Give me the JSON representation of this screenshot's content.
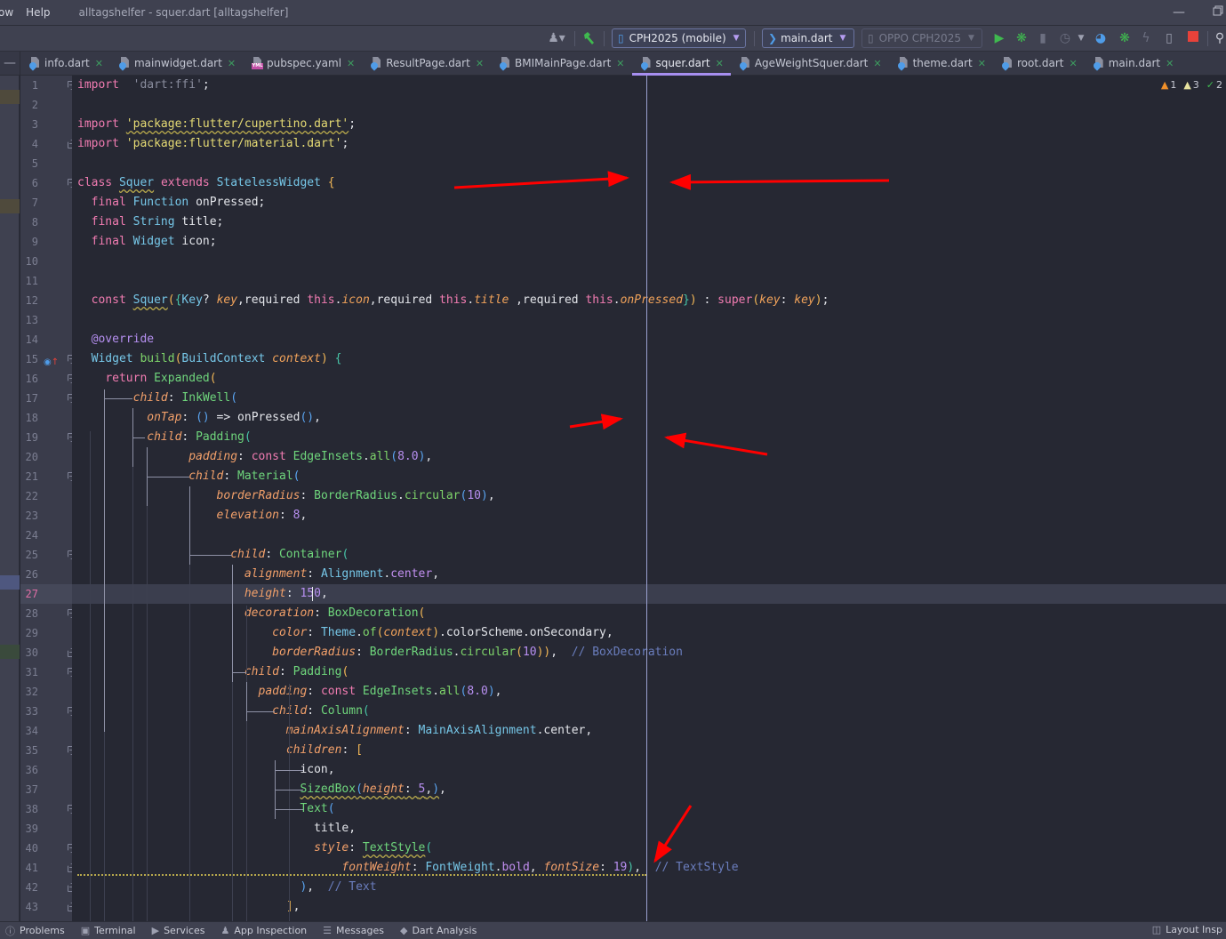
{
  "titlebar": {
    "menus": [
      "ow",
      "Help"
    ],
    "window_title": "alltagshelfer - squer.dart [alltagshelfer]",
    "minimize_icon": "minimize-icon",
    "restore_icon": "restore-icon"
  },
  "toolbar": {
    "device_combo": "CPH2025 (mobile)",
    "run_config_combo": "main.dart",
    "target_device_combo": "OPPO CPH2025",
    "icons": [
      "user-icon",
      "build-hammer-icon",
      "run-icon",
      "debug-icon",
      "attach-icon",
      "profile-icon",
      "more-dropdown-icon",
      "performance-icon",
      "debug-attach-icon",
      "hot-reload-icon",
      "device-manager-icon",
      "stop-icon",
      "search-icon"
    ],
    "colors": {
      "run": "#3fb94f",
      "stop": "#e8423a",
      "accent": "#a78ff0"
    }
  },
  "tabs": [
    {
      "label": "info.dart",
      "type": "dart"
    },
    {
      "label": "mainwidget.dart",
      "type": "dart"
    },
    {
      "label": "pubspec.yaml",
      "type": "yaml"
    },
    {
      "label": "ResultPage.dart",
      "type": "dart"
    },
    {
      "label": "BMIMainPage.dart",
      "type": "dart"
    },
    {
      "label": "squer.dart",
      "type": "dart",
      "active": true
    },
    {
      "label": "AgeWeightSquer.dart",
      "type": "dart"
    },
    {
      "label": "theme.dart",
      "type": "dart"
    },
    {
      "label": "root.dart",
      "type": "dart"
    },
    {
      "label": "main.dart",
      "type": "dart"
    }
  ],
  "inspections": {
    "errors": "1",
    "warnings": "3",
    "weak_warnings": "2"
  },
  "editor": {
    "current_line": 27,
    "line_numbers": [
      "1",
      "2",
      "3",
      "4",
      "5",
      "6",
      "7",
      "8",
      "9",
      "10",
      "11",
      "12",
      "13",
      "14",
      "15",
      "16",
      "17",
      "18",
      "19",
      "20",
      "21",
      "22",
      "23",
      "24",
      "25",
      "26",
      "27",
      "28",
      "29",
      "30",
      "31",
      "32",
      "33",
      "34",
      "35",
      "36",
      "37",
      "38",
      "39",
      "40",
      "41",
      "42",
      "43"
    ],
    "lines": [
      [
        [
          "kw",
          "import"
        ],
        [
          "",
          "  "
        ],
        [
          "str-gray",
          "'dart:ffi'"
        ],
        [
          "",
          ";"
        ]
      ],
      [],
      [
        [
          "kw",
          "import"
        ],
        [
          "",
          " "
        ],
        [
          "str squiggle",
          "'package:flutter/cupertino.dart'"
        ],
        [
          "",
          ";"
        ]
      ],
      [
        [
          "kw",
          "import"
        ],
        [
          "",
          " "
        ],
        [
          "str",
          "'package:flutter/material.dart'"
        ],
        [
          "",
          ";"
        ]
      ],
      [],
      [
        [
          "kw",
          "class"
        ],
        [
          "",
          " "
        ],
        [
          "cls squiggle",
          "Squer"
        ],
        [
          "",
          " "
        ],
        [
          "kw",
          "extends"
        ],
        [
          "",
          " "
        ],
        [
          "cls",
          "StatelessWidget"
        ],
        [
          "",
          " "
        ],
        [
          "paren",
          "{"
        ]
      ],
      [
        [
          "",
          "  "
        ],
        [
          "kw",
          "final"
        ],
        [
          "",
          " "
        ],
        [
          "cls",
          "Function"
        ],
        [
          "",
          " onPressed;"
        ]
      ],
      [
        [
          "",
          "  "
        ],
        [
          "kw",
          "final"
        ],
        [
          "",
          " "
        ],
        [
          "cls",
          "String"
        ],
        [
          "",
          " title;"
        ]
      ],
      [
        [
          "",
          "  "
        ],
        [
          "kw",
          "final"
        ],
        [
          "",
          " "
        ],
        [
          "cls",
          "Widget"
        ],
        [
          "",
          " icon;"
        ]
      ],
      [],
      [],
      [
        [
          "",
          "  "
        ],
        [
          "kw",
          "const"
        ],
        [
          "",
          " "
        ],
        [
          "cls squiggle",
          "Squer"
        ],
        [
          "paren",
          "("
        ],
        [
          "paren3",
          "{"
        ],
        [
          "cls",
          "Key"
        ],
        [
          "",
          "? "
        ],
        [
          "param",
          "key"
        ],
        [
          "",
          ",required "
        ],
        [
          "kw",
          "this"
        ],
        [
          "",
          "."
        ],
        [
          "param",
          "icon"
        ],
        [
          "",
          ",required "
        ],
        [
          "kw",
          "this"
        ],
        [
          "",
          "."
        ],
        [
          "param",
          "title"
        ],
        [
          "",
          " ,required "
        ],
        [
          "kw",
          "this"
        ],
        [
          "",
          "."
        ],
        [
          "param",
          "onPressed"
        ],
        [
          "paren3",
          "}"
        ],
        [
          "paren",
          ")"
        ],
        [
          "",
          " : "
        ],
        [
          "kw",
          "super"
        ],
        [
          "paren",
          "("
        ],
        [
          "param",
          "key"
        ],
        [
          "",
          ": "
        ],
        [
          "param",
          "key"
        ],
        [
          "paren",
          ")"
        ],
        [
          "",
          ";"
        ]
      ],
      [],
      [
        [
          "",
          "  "
        ],
        [
          "meta",
          "@override"
        ]
      ],
      [
        [
          "",
          "  "
        ],
        [
          "cls",
          "Widget"
        ],
        [
          "",
          " "
        ],
        [
          "fn",
          "build"
        ],
        [
          "paren",
          "("
        ],
        [
          "cls",
          "BuildContext"
        ],
        [
          "",
          " "
        ],
        [
          "param",
          "context"
        ],
        [
          "paren",
          ")"
        ],
        [
          "",
          " "
        ],
        [
          "paren3",
          "{"
        ]
      ],
      [
        [
          "",
          "    "
        ],
        [
          "kw",
          "return"
        ],
        [
          "",
          " "
        ],
        [
          "ctor",
          "Expanded"
        ],
        [
          "paren",
          "("
        ]
      ],
      [
        [
          "",
          "        "
        ],
        [
          "prop",
          "child"
        ],
        [
          "",
          ": "
        ],
        [
          "ctor",
          "InkWell"
        ],
        [
          "paren2",
          "("
        ]
      ],
      [
        [
          "",
          "          "
        ],
        [
          "prop",
          "onTap"
        ],
        [
          "",
          ": "
        ],
        [
          "paren2",
          "()"
        ],
        [
          "",
          " => onPressed"
        ],
        [
          "paren2",
          "()"
        ],
        [
          "",
          ","
        ]
      ],
      [
        [
          "",
          "          "
        ],
        [
          "prop",
          "child"
        ],
        [
          "",
          ": "
        ],
        [
          "ctor",
          "Padding"
        ],
        [
          "paren3",
          "("
        ]
      ],
      [
        [
          "",
          "                "
        ],
        [
          "prop",
          "padding"
        ],
        [
          "",
          ": "
        ],
        [
          "kw",
          "const"
        ],
        [
          "",
          " "
        ],
        [
          "ctor",
          "EdgeInsets"
        ],
        [
          "",
          "."
        ],
        [
          "fn",
          "all"
        ],
        [
          "paren2",
          "("
        ],
        [
          "num",
          "8.0"
        ],
        [
          "paren2",
          ")"
        ],
        [
          "",
          ","
        ]
      ],
      [
        [
          "",
          "                "
        ],
        [
          "prop",
          "child"
        ],
        [
          "",
          ": "
        ],
        [
          "ctor",
          "Material"
        ],
        [
          "paren2",
          "("
        ]
      ],
      [
        [
          "",
          "                    "
        ],
        [
          "prop",
          "borderRadius"
        ],
        [
          "",
          ": "
        ],
        [
          "ctor",
          "BorderRadius"
        ],
        [
          "",
          "."
        ],
        [
          "fn",
          "circular"
        ],
        [
          "paren2",
          "("
        ],
        [
          "num",
          "10"
        ],
        [
          "paren2",
          ")"
        ],
        [
          "",
          ","
        ]
      ],
      [
        [
          "",
          "                    "
        ],
        [
          "prop",
          "elevation"
        ],
        [
          "",
          ": "
        ],
        [
          "num",
          "8"
        ],
        [
          "",
          ","
        ]
      ],
      [],
      [
        [
          "",
          "                      "
        ],
        [
          "prop",
          "child"
        ],
        [
          "",
          ": "
        ],
        [
          "ctor",
          "Container"
        ],
        [
          "paren3",
          "("
        ]
      ],
      [
        [
          "",
          "                        "
        ],
        [
          "prop",
          "alignment"
        ],
        [
          "",
          ": "
        ],
        [
          "cls",
          "Alignment"
        ],
        [
          "",
          "."
        ],
        [
          "enumv",
          "center"
        ],
        [
          "",
          ","
        ]
      ],
      [
        [
          "",
          "                        "
        ],
        [
          "prop",
          "height"
        ],
        [
          "",
          ": "
        ],
        [
          "num",
          "150"
        ],
        [
          "",
          ","
        ]
      ],
      [
        [
          "",
          "                        "
        ],
        [
          "prop",
          "decoration"
        ],
        [
          "",
          ": "
        ],
        [
          "ctor",
          "BoxDecoration"
        ],
        [
          "paren",
          "("
        ]
      ],
      [
        [
          "",
          "                            "
        ],
        [
          "prop",
          "color"
        ],
        [
          "",
          ": "
        ],
        [
          "cls",
          "Theme"
        ],
        [
          "",
          "."
        ],
        [
          "fn",
          "of"
        ],
        [
          "paren",
          "("
        ],
        [
          "param",
          "context"
        ],
        [
          "paren",
          ")"
        ],
        [
          "",
          ".colorScheme.onSecondary,"
        ]
      ],
      [
        [
          "",
          "                            "
        ],
        [
          "prop",
          "borderRadius"
        ],
        [
          "",
          ": "
        ],
        [
          "ctor",
          "BorderRadius"
        ],
        [
          "",
          "."
        ],
        [
          "fn",
          "circular"
        ],
        [
          "paren",
          "("
        ],
        [
          "num",
          "10"
        ],
        [
          "paren",
          "))"
        ],
        [
          "",
          ",  "
        ],
        [
          "cmt",
          "// BoxDecoration"
        ]
      ],
      [
        [
          "",
          "                        "
        ],
        [
          "prop",
          "child"
        ],
        [
          "",
          ": "
        ],
        [
          "ctor",
          "Padding"
        ],
        [
          "paren",
          "("
        ]
      ],
      [
        [
          "",
          "                          "
        ],
        [
          "prop",
          "padding"
        ],
        [
          "",
          ": "
        ],
        [
          "kw",
          "const"
        ],
        [
          "",
          " "
        ],
        [
          "ctor",
          "EdgeInsets"
        ],
        [
          "",
          "."
        ],
        [
          "fn",
          "all"
        ],
        [
          "paren2",
          "("
        ],
        [
          "num",
          "8.0"
        ],
        [
          "paren2",
          ")"
        ],
        [
          "",
          ","
        ]
      ],
      [
        [
          "",
          "                            "
        ],
        [
          "prop",
          "child"
        ],
        [
          "",
          ": "
        ],
        [
          "ctor",
          "Column"
        ],
        [
          "paren3",
          "("
        ]
      ],
      [
        [
          "",
          "                              "
        ],
        [
          "prop",
          "mainAxisAlignment"
        ],
        [
          "",
          ": "
        ],
        [
          "cls",
          "MainAxisAlignment"
        ],
        [
          "",
          ".center,"
        ]
      ],
      [
        [
          "",
          "                              "
        ],
        [
          "prop",
          "children"
        ],
        [
          "",
          ": "
        ],
        [
          "paren",
          "["
        ]
      ],
      [
        [
          "",
          "                                "
        ],
        [
          "",
          "icon,"
        ]
      ],
      [
        [
          "",
          "                                "
        ],
        [
          "ctor squiggle",
          "SizedBox"
        ],
        [
          "paren2 squiggle",
          "("
        ],
        [
          "prop squiggle",
          "height"
        ],
        [
          "squiggle",
          ": "
        ],
        [
          "num squiggle",
          "5"
        ],
        [
          "squiggle",
          ","
        ],
        [
          "paren2 squiggle",
          ")"
        ],
        [
          "",
          ","
        ]
      ],
      [
        [
          "",
          "                                "
        ],
        [
          "ctor",
          "Text"
        ],
        [
          "paren2",
          "("
        ]
      ],
      [
        [
          "",
          "                                  "
        ],
        [
          "",
          "title,"
        ]
      ],
      [
        [
          "",
          "                                  "
        ],
        [
          "prop",
          "style"
        ],
        [
          "",
          ": "
        ],
        [
          "ctor squiggle",
          "TextStyle"
        ],
        [
          "paren3",
          "("
        ]
      ],
      [
        [
          "",
          "                                      "
        ],
        [
          "prop",
          "fontWeight"
        ],
        [
          "",
          ": "
        ],
        [
          "cls",
          "FontWeight"
        ],
        [
          "",
          "."
        ],
        [
          "enumv",
          "bold"
        ],
        [
          "",
          ", "
        ],
        [
          "prop",
          "fontSize"
        ],
        [
          "",
          ": "
        ],
        [
          "num",
          "19"
        ],
        [
          "paren3",
          ")"
        ],
        [
          "",
          ",  "
        ],
        [
          "cmt",
          "// TextStyle"
        ]
      ],
      [
        [
          "",
          "                                "
        ],
        [
          "paren2",
          ")"
        ],
        [
          "",
          ",  "
        ],
        [
          "cmt",
          "// Text"
        ]
      ],
      [
        [
          "",
          "                              "
        ],
        [
          "paren",
          "]"
        ],
        [
          "",
          ","
        ]
      ]
    ],
    "annotations": "Four red arrows point at the right-margin guide; a fifth arrow points at the end of line 41"
  },
  "bottom_bar": {
    "items": [
      {
        "label": "Problems",
        "icon": "problems-icon"
      },
      {
        "label": "Terminal",
        "icon": "terminal-icon"
      },
      {
        "label": "Services",
        "icon": "services-icon"
      },
      {
        "label": "App Inspection",
        "icon": "app-inspection-icon"
      },
      {
        "label": "Messages",
        "icon": "messages-icon"
      },
      {
        "label": "Dart Analysis",
        "icon": "dart-analysis-icon"
      }
    ],
    "right_item": {
      "label": "Layout Insp",
      "icon": "layout-inspector-icon"
    }
  }
}
